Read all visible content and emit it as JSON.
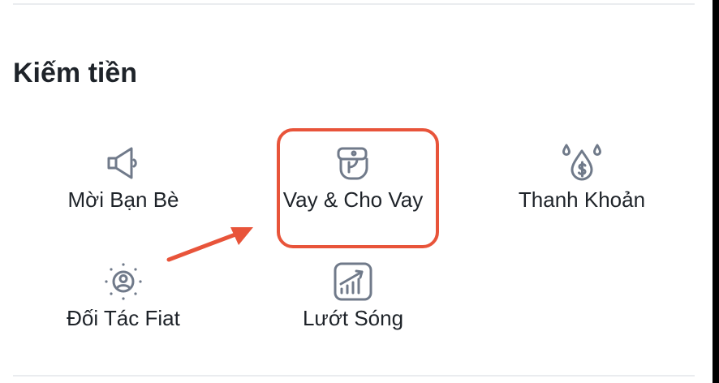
{
  "section": {
    "title": "Kiếm tiền"
  },
  "items": [
    {
      "label": "Mời Bạn Bè",
      "icon": "megaphone-icon"
    },
    {
      "label": "Vay & Cho Vay",
      "icon": "loan-hand-icon"
    },
    {
      "label": "Thanh Khoản",
      "icon": "liquidity-drops-icon"
    },
    {
      "label": "Đối Tác Fiat",
      "icon": "partner-user-icon"
    },
    {
      "label": "Lướt Sóng",
      "icon": "chart-growth-icon"
    }
  ],
  "colors": {
    "icon_stroke": "#707a8a",
    "text": "#1e2329",
    "annotation": "#e8543a",
    "divider": "#eaecef"
  }
}
